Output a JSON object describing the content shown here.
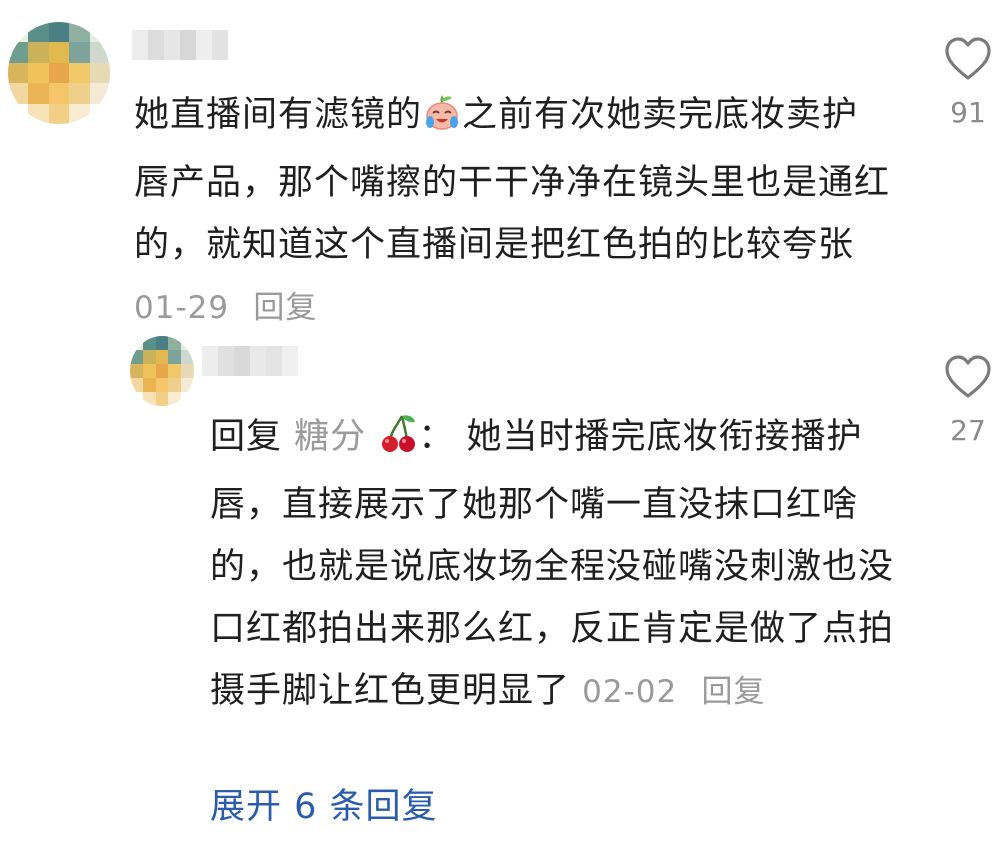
{
  "comment": {
    "avatar_icon": "blurred-avatar-icon",
    "text": "她直播间有滤镜的",
    "emoji_icon": "crying-laughing-peach-emoji-icon",
    "text2": "之前有次她卖完底妆卖护唇产品，那个嘴擦的干干净净在镜头里也是通红的，就知道这个直播间是把红色拍的比较夸张",
    "date": "01-29",
    "reply_label": "回复",
    "like_icon": "heart-outline-icon",
    "likes": "91"
  },
  "reply": {
    "avatar_icon": "blurred-avatar-icon",
    "prefix": "回复",
    "target_user": "糖分",
    "cherry_icon": "cherry-emoji-icon",
    "separator": "：",
    "text": "她当时播完底妆衔接播护唇，直接展示了她那个嘴一直没抹口红啥的，也就是说底妆场全程没碰嘴没刺激也没口红都拍出来那么红，反正肯定是做了点拍摄手脚让红色更明显了",
    "date": "02-02",
    "reply_label": "回复",
    "like_icon": "heart-outline-icon",
    "likes": "27"
  },
  "expand_replies": "展开 6 条回复",
  "colors": {
    "text": "#1f1f1f",
    "meta": "#9a9a9a",
    "link": "#2a5caa"
  }
}
